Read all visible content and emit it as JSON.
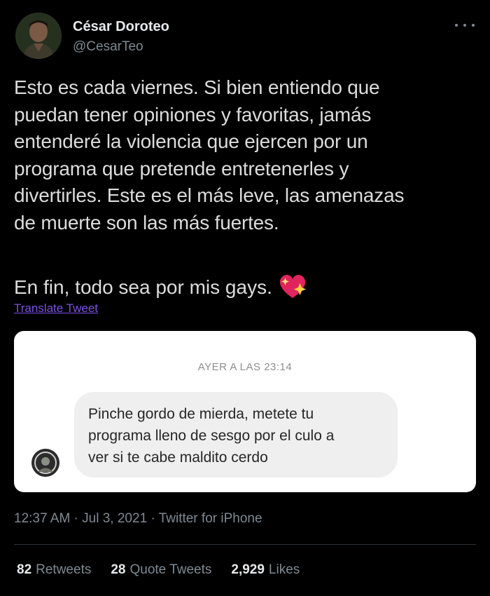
{
  "author": {
    "name": "César Doroteo",
    "handle": "@CesarTeo"
  },
  "tweet": {
    "paragraph1": "Esto es cada viernes. Si bien entiendo que\npuedan tener opiniones y favoritas, jamás\nentenderé la violencia que ejercen por un\nprograma que pretende entretenerles y\ndivertirles. Este es el más leve, las amenazas\nde muerte son las más fuertes.",
    "paragraph2": "En fin, todo sea por mis gays.",
    "emoji_icon": "sparkling-heart-icon",
    "translate_label": "Translate Tweet"
  },
  "media": {
    "timestamp": "AYER A LAS 23:14",
    "message": "Pinche gordo de mierda, metete tu\nprograma lleno de sesgo por el culo a\nver si te cabe maldito cerdo"
  },
  "meta": {
    "time": "12:37 AM",
    "separator1": " · ",
    "date": "Jul 3, 2021",
    "separator2": " · ",
    "source": "Twitter for iPhone"
  },
  "stats": {
    "retweets_count": "82",
    "retweets_label": "Retweets",
    "quotes_count": "28",
    "quotes_label": "Quote Tweets",
    "likes_count": "2,929",
    "likes_label": "Likes"
  },
  "colors": {
    "background": "#000000",
    "text": "#d9d9d9",
    "muted": "#7f8a93",
    "link": "#7d4fe8",
    "heart": "#e0245e"
  }
}
